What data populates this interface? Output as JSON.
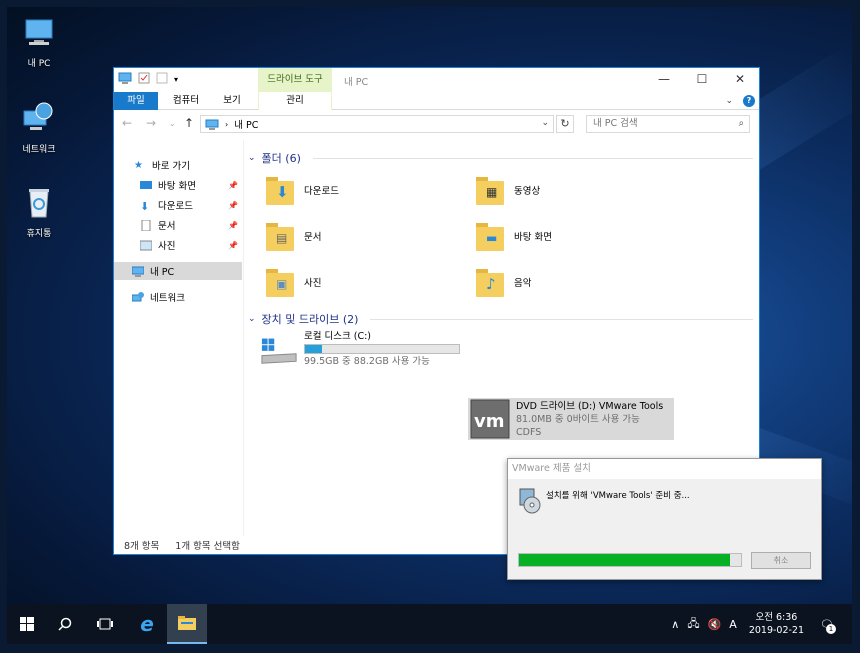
{
  "desktop": {
    "icons": [
      {
        "label": "내 PC"
      },
      {
        "label": "네트워크"
      },
      {
        "label": "휴지통"
      }
    ]
  },
  "explorer": {
    "title": "내 PC",
    "context_tab": "드라이브 도구",
    "ribbon_tabs": {
      "file": "파일",
      "computer": "컴퓨터",
      "view": "보기",
      "manage": "관리"
    },
    "address": "내 PC",
    "search_placeholder": "내 PC 검색",
    "nav": {
      "quick_access": "바로 가기",
      "desktop": "바탕 화면",
      "downloads": "다운로드",
      "documents": "문서",
      "pictures": "사진",
      "this_pc": "내 PC",
      "network": "네트워크"
    },
    "folders_header": "폴더 (6)",
    "folders": [
      "다운로드",
      "동영상",
      "문서",
      "바탕 화면",
      "사진",
      "음악"
    ],
    "drives_header": "장치 및 드라이브 (2)",
    "drives": [
      {
        "name": "로컬 디스크 (C:)",
        "space": "99.5GB 중 88.2GB 사용 가능",
        "used_fraction": 0.11
      },
      {
        "name": "DVD 드라이브 (D:) VMware Tools",
        "space": "81.0MB 중 0바이트 사용 가능",
        "fs": "CDFS"
      }
    ],
    "status": {
      "items": "8개 항목",
      "selected": "1개 항목 선택함"
    }
  },
  "vmware_dialog": {
    "title": "VMware 제품 설치",
    "message": "설치를 위해 'VMware Tools' 준비 중...",
    "progress": 0.95,
    "cancel": "취소"
  },
  "taskbar": {
    "time": "오전 6:36",
    "date": "2019-02-21",
    "ime": "A",
    "notification_count": "1"
  },
  "colors": {
    "accent": "#1979ca",
    "progress": "#06b025",
    "drive_bar": "#26a0da"
  }
}
